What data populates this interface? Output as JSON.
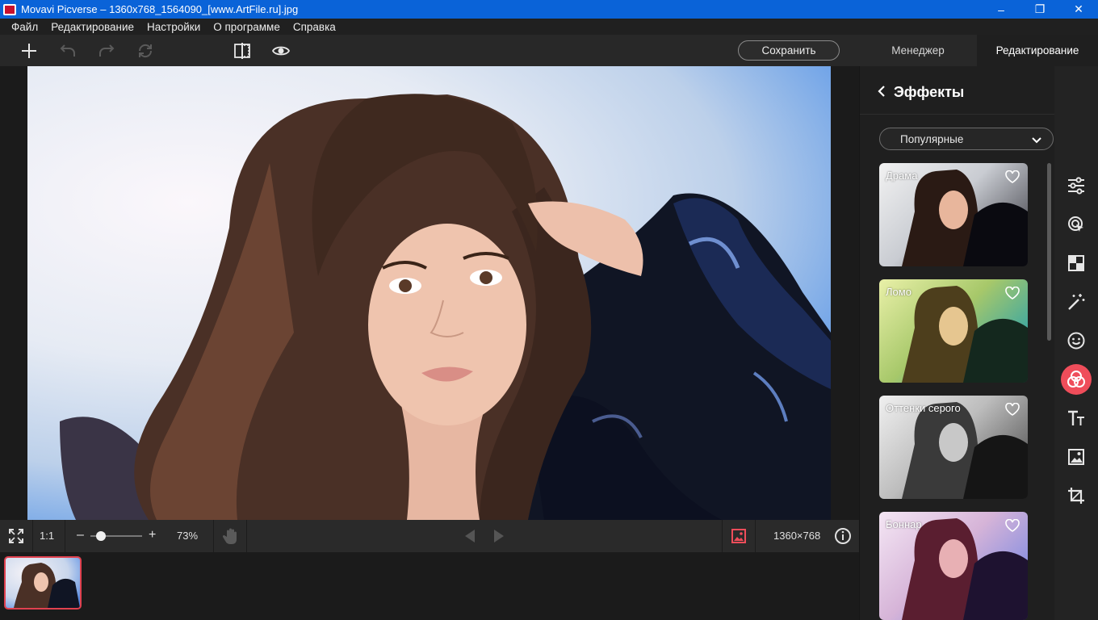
{
  "window": {
    "title": "Movavi Picverse – 1360x768_1564090_[www.ArtFile.ru].jpg",
    "minimize_glyph": "–",
    "maximize_glyph": "❐",
    "close_glyph": "✕"
  },
  "menu": {
    "items": [
      "Файл",
      "Редактирование",
      "Настройки",
      "О программе",
      "Справка"
    ]
  },
  "toolbar": {
    "icons": [
      "add-icon",
      "undo-icon",
      "redo-icon",
      "reset-icon",
      "compare-icon",
      "preview-eye-icon"
    ],
    "save_label": "Сохранить",
    "tabs": [
      {
        "label": "Менеджер",
        "active": false
      },
      {
        "label": "Редактирование",
        "active": true
      }
    ]
  },
  "statusbar": {
    "fit_icon": "fit-screen-icon",
    "actual_size_label": "1:1",
    "zoom_minus": "–",
    "zoom_plus": "+",
    "zoom_value": 0.2,
    "zoom_label": "73%",
    "hand_icon": "hand-icon",
    "prev_icon": "prev-arrow-icon",
    "next_icon": "next-arrow-icon",
    "image_icon": "image-icon",
    "dimensions": "1360×768",
    "info_icon": "info-icon"
  },
  "panel": {
    "title": "Эффекты",
    "category": "Популярные",
    "effects": [
      {
        "label": "Драма",
        "tint": "#2a2320"
      },
      {
        "label": "Ломо",
        "tint": "#6e8f3a"
      },
      {
        "label": "Оттенки серого",
        "tint": "#7a7a7a"
      },
      {
        "label": "Боннар",
        "tint": "#8b3a5c"
      }
    ]
  },
  "rail": {
    "icons": [
      {
        "name": "adjust-sliders-icon",
        "active": false
      },
      {
        "name": "retouch-cursor-icon",
        "active": false
      },
      {
        "name": "background-icon",
        "active": false
      },
      {
        "name": "magic-wand-icon",
        "active": false
      },
      {
        "name": "face-icon",
        "active": false
      },
      {
        "name": "effects-icon",
        "active": true
      },
      {
        "name": "text-icon",
        "active": false
      },
      {
        "name": "watermark-image-icon",
        "active": false
      },
      {
        "name": "crop-icon",
        "active": false
      }
    ]
  },
  "colors": {
    "accent": "#ef4d5a",
    "titlebar": "#0a63d8"
  }
}
